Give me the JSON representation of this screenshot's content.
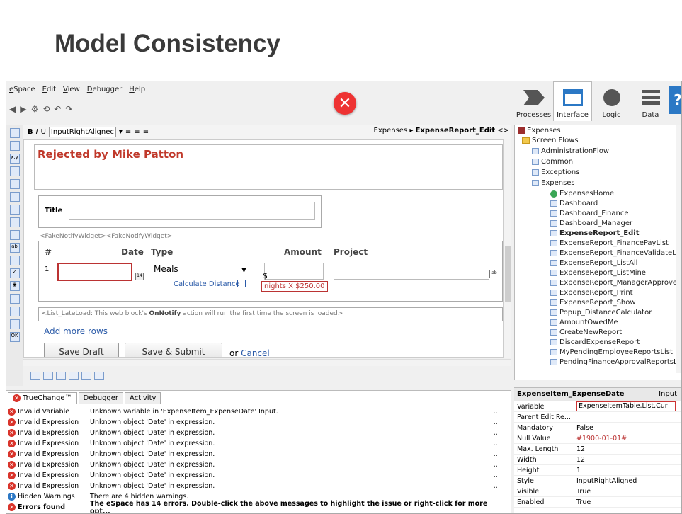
{
  "slide": {
    "title": "Model Consistency"
  },
  "menu": [
    "eSpace",
    "Edit",
    "View",
    "Debugger",
    "Help"
  ],
  "right_tabs": [
    "Processes",
    "Interface",
    "Logic",
    "Data"
  ],
  "editor": {
    "style_select": "InputRightAlignec",
    "breadcrumb_parent": "Expenses",
    "breadcrumb_current": "ExpenseReport_Edit",
    "rejected_text": "Rejected by Mike Patton",
    "title_label": "Title",
    "widget_tag": "<FakeNotifyWidget><FakeNotifyWidget>",
    "columns": {
      "num": "#",
      "date": "Date",
      "type": "Type",
      "amount": "Amount",
      "project": "Project"
    },
    "row_no": "1",
    "type_value": "Meals",
    "calc_link": "Calculate Distance",
    "dollar": "$",
    "nights": "nights X $250.00",
    "lateload_prefix": "<List_LateLoad: This web block's ",
    "lateload_bold": "OnNotify",
    "lateload_suffix": " action will run the first time the screen is loaded>",
    "add_rows": "Add more rows",
    "save_draft": "Save Draft",
    "save_submit": "Save & Submit",
    "or": "or ",
    "cancel": "Cancel"
  },
  "tree": {
    "root": "Expenses",
    "screen_flows": "Screen Flows",
    "flows": [
      "AdministrationFlow",
      "Common",
      "Exceptions",
      "Expenses"
    ],
    "screens": [
      "ExpensesHome",
      "Dashboard",
      "Dashboard_Finance",
      "Dashboard_Manager",
      "ExpenseReport_Edit",
      "ExpenseReport_FinancePayList",
      "ExpenseReport_FinanceValidateLi",
      "ExpenseReport_ListAll",
      "ExpenseReport_ListMine",
      "ExpenseReport_ManagerApprove",
      "ExpenseReport_Print",
      "ExpenseReport_Show",
      "Popup_DistanceCalculator",
      "AmountOwedMe",
      "CreateNewReport",
      "DiscardExpenseReport",
      "MyPendingEmployeeReportsList",
      "PendingFinanceApprovalReportsL"
    ]
  },
  "props": {
    "header": "ExpenseItem_ExpenseDate",
    "kind": "Input",
    "rows": [
      {
        "name": "Variable",
        "value": "ExpenseItemTable.List.Cur"
      },
      {
        "name": "Parent Edit Re...",
        "value": ""
      },
      {
        "name": "Mandatory",
        "value": "False"
      },
      {
        "name": "Null Value",
        "value": "#1900-01-01#"
      },
      {
        "name": "Max. Length",
        "value": "12"
      },
      {
        "name": "Width",
        "value": "12"
      },
      {
        "name": "Height",
        "value": "1"
      },
      {
        "name": "Style",
        "value": "InputRightAligned"
      },
      {
        "name": "Visible",
        "value": "True"
      },
      {
        "name": "Enabled",
        "value": "True"
      }
    ]
  },
  "messages": {
    "tabs": [
      "TrueChange™",
      "Debugger",
      "Activity"
    ],
    "rows": [
      {
        "kind": "Invalid Variable",
        "msg": "Unknown variable in 'ExpenseItem_ExpenseDate' Input.",
        "icon": "error"
      },
      {
        "kind": "Invalid Expression",
        "msg": "Unknown object 'Date' in expression.",
        "icon": "error"
      },
      {
        "kind": "Invalid Expression",
        "msg": "Unknown object 'Date' in expression.",
        "icon": "error"
      },
      {
        "kind": "Invalid Expression",
        "msg": "Unknown object 'Date' in expression.",
        "icon": "error"
      },
      {
        "kind": "Invalid Expression",
        "msg": "Unknown object 'Date' in expression.",
        "icon": "error"
      },
      {
        "kind": "Invalid Expression",
        "msg": "Unknown object 'Date' in expression.",
        "icon": "error"
      },
      {
        "kind": "Invalid Expression",
        "msg": "Unknown object 'Date' in expression.",
        "icon": "error"
      },
      {
        "kind": "Invalid Expression",
        "msg": "Unknown object 'Date' in expression.",
        "icon": "error"
      },
      {
        "kind": "Hidden Warnings",
        "msg": "There are 4 hidden warnings.",
        "icon": "info"
      },
      {
        "kind": "Errors found",
        "msg": "The eSpace has 14 errors. Double-click the above messages to highlight the issue or right-click for more opt...",
        "icon": "error"
      }
    ]
  }
}
